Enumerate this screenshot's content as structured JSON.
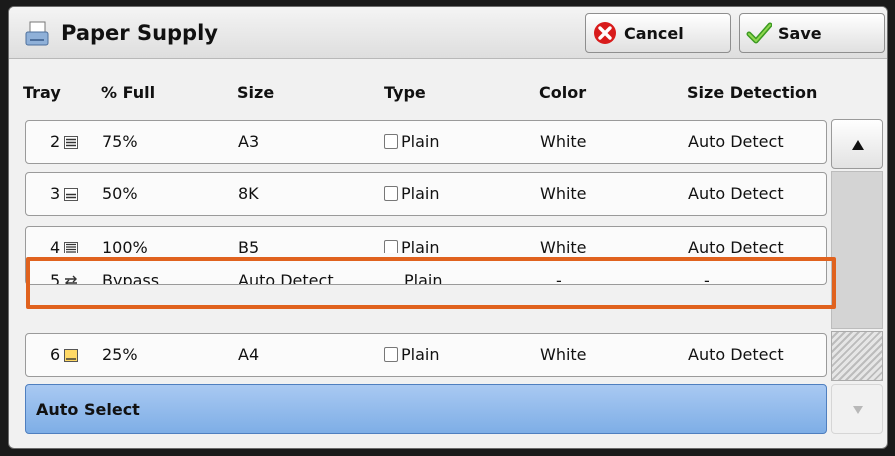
{
  "dialog": {
    "title": "Paper Supply",
    "cancel_label": "Cancel",
    "save_label": "Save"
  },
  "columns": {
    "tray": "Tray",
    "full": "% Full",
    "size": "Size",
    "type": "Type",
    "color": "Color",
    "detection": "Size Detection"
  },
  "rows": [
    {
      "tray": "2",
      "full": "75%",
      "size": "A3",
      "type": "Plain",
      "color": "White",
      "detection": "Auto Detect"
    },
    {
      "tray": "3",
      "full": "50%",
      "size": "8K",
      "type": "Plain",
      "color": "White",
      "detection": "Auto Detect"
    },
    {
      "tray": "4",
      "full": "100%",
      "size": "B5",
      "type": "Plain",
      "color": "White",
      "detection": "Auto Detect"
    },
    {
      "tray": "5",
      "full": "Bypass",
      "size": "Auto Detect",
      "type": "Plain",
      "color": "-",
      "detection": "-"
    },
    {
      "tray": "6",
      "full": "25%",
      "size": "A4",
      "type": "Plain",
      "color": "White",
      "detection": "Auto Detect"
    }
  ],
  "auto_select_label": "Auto Select",
  "colors": {
    "highlight": "#e0621e",
    "auto_select": "#7eaee6"
  }
}
